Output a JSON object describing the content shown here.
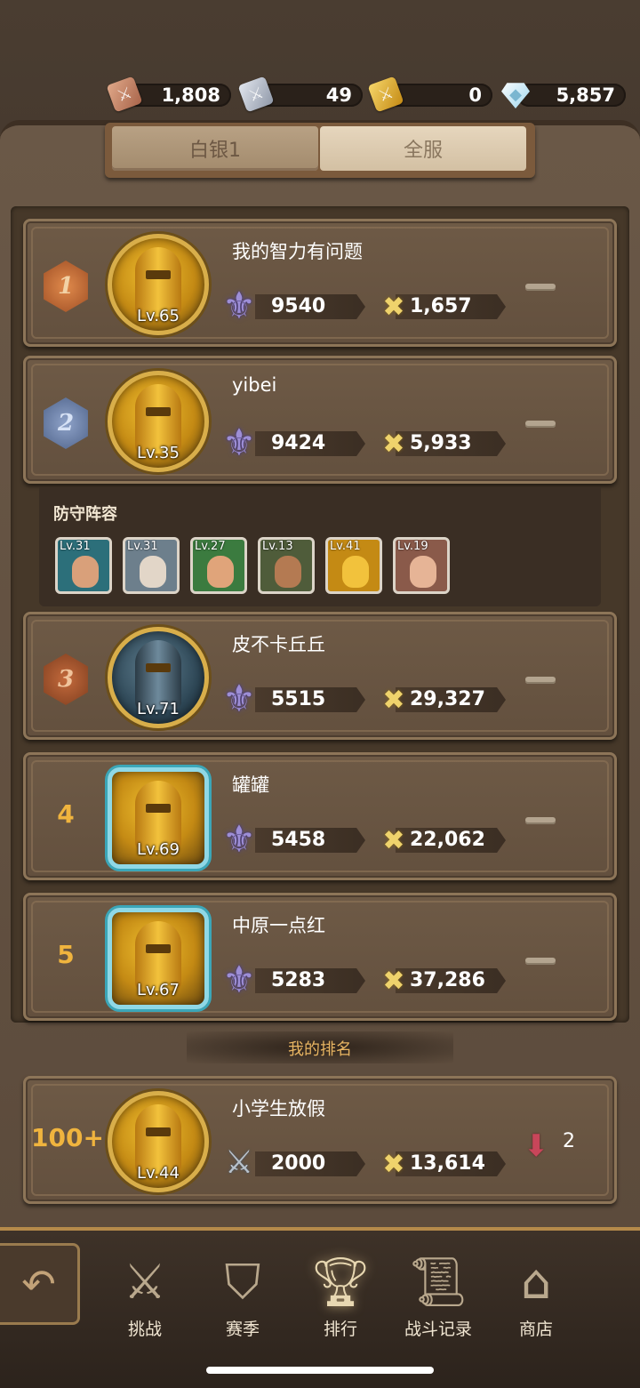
{
  "currencies": [
    {
      "icon": "copper-ticket-icon",
      "value": "1,808",
      "color": "#c98a6a"
    },
    {
      "icon": "silver-ticket-icon",
      "value": "49",
      "color": "#b8c0cc"
    },
    {
      "icon": "gold-ticket-icon",
      "value": "0",
      "color": "#e6b43a"
    },
    {
      "icon": "diamond-icon",
      "value": "5,857",
      "color": "#bfe6f6"
    }
  ],
  "tabs": {
    "active": "白银1",
    "inactive": "全服"
  },
  "ranking": [
    {
      "rank": "1",
      "name": "我的智力有问题",
      "level": "Lv.65",
      "trophies": "9540",
      "power": "1,657"
    },
    {
      "rank": "2",
      "name": "yibei",
      "level": "Lv.35",
      "trophies": "9424",
      "power": "5,933"
    },
    {
      "rank": "3",
      "name": "皮不卡丘丘",
      "level": "Lv.71",
      "trophies": "5515",
      "power": "29,327"
    },
    {
      "rank": "4",
      "name": "罐罐",
      "level": "Lv.69",
      "trophies": "5458",
      "power": "22,062"
    },
    {
      "rank": "5",
      "name": "中原一点红",
      "level": "Lv.67",
      "trophies": "5283",
      "power": "37,286"
    }
  ],
  "defense": {
    "title": "防守阵容",
    "heroes": [
      {
        "level": "Lv.31",
        "bg": "#2c6f7a",
        "face": "#d9a07a"
      },
      {
        "level": "Lv.31",
        "bg": "#6d7f8c",
        "face": "#e2d6c8"
      },
      {
        "level": "Lv.27",
        "bg": "#3b7b3f",
        "face": "#e0a47a"
      },
      {
        "level": "Lv.13",
        "bg": "#4f5c3a",
        "face": "#b47a52"
      },
      {
        "level": "Lv.41",
        "bg": "#c48a14",
        "face": "#f2c23c"
      },
      {
        "level": "Lv.19",
        "bg": "#8a5a4a",
        "face": "#e6b496"
      }
    ]
  },
  "my_rank": {
    "label": "我的排名",
    "rank": "100+",
    "name": "小学生放假",
    "level": "Lv.44",
    "trophies": "2000",
    "power": "13,614",
    "change": "2"
  },
  "nav": [
    {
      "label": "挑战",
      "icon": "crossed-swords-icon"
    },
    {
      "label": "赛季",
      "icon": "shield-wings-icon"
    },
    {
      "label": "排行",
      "icon": "trophy-icon"
    },
    {
      "label": "战斗记录",
      "icon": "scroll-icon"
    },
    {
      "label": "商店",
      "icon": "shop-icon"
    }
  ]
}
